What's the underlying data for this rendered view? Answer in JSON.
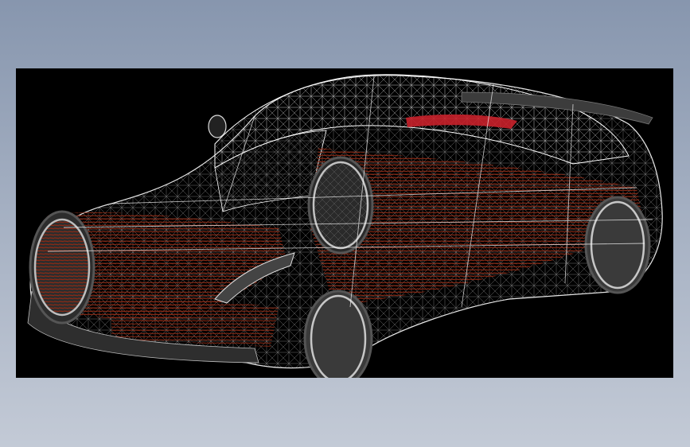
{
  "app": {
    "background_top": "#8796ae",
    "background_bottom": "#c3cad6"
  },
  "viewport": {
    "background": "#000000",
    "model": "sports-car-wireframe",
    "wire_color": "#d8d8d8",
    "body_color": "#7a2414",
    "tail_light_color": "#c8202a",
    "tire_color": "#3a3a3a"
  }
}
